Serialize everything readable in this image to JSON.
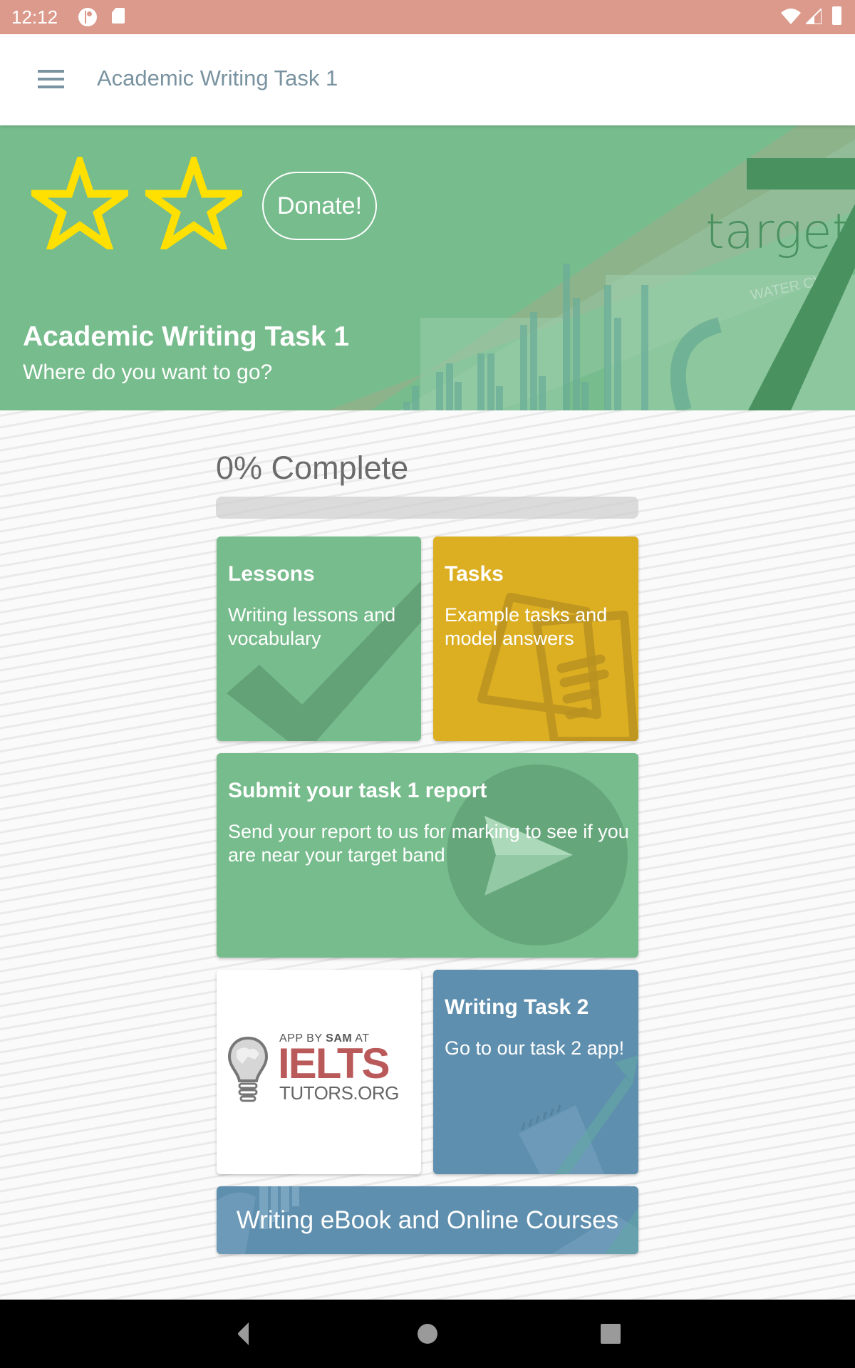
{
  "status_bar": {
    "time": "12:12",
    "icons": [
      "notification-ring-icon",
      "sd-card-icon",
      "wifi-icon",
      "cell-signal-icon",
      "battery-icon"
    ]
  },
  "app_bar": {
    "menu_icon": "hamburger-menu-icon",
    "title": "Academic Writing Task 1"
  },
  "hero": {
    "rating_stars": 2,
    "donate_label": "Donate!",
    "title": "Academic Writing Task 1",
    "subtitle": "Where do you want to go?",
    "background_word": "target",
    "colors": {
      "background": "#77bc8c",
      "star": "#ffe000"
    }
  },
  "progress": {
    "label": "0% Complete",
    "percent": 0
  },
  "tiles": {
    "lessons": {
      "title": "Lessons",
      "description": "Writing lessons and vocabulary",
      "icon": "checkmark-icon",
      "color": "#77bc8c"
    },
    "tasks": {
      "title": "Tasks",
      "description": "Example tasks and model answers",
      "icon": "documents-icon",
      "color": "#dcae22"
    },
    "submit": {
      "title": "Submit your task 1 report",
      "description": "Send your report to us for marking to see if you are near your target band",
      "icon": "paper-plane-icon",
      "color": "#77bc8c"
    },
    "logo": {
      "line1_prefix": "APP BY ",
      "line1_bold": "SAM",
      "line1_suffix": " AT",
      "brand": "IELTS",
      "line3": "TUTORS.ORG",
      "icon": "lightbulb-globe-icon"
    },
    "task2": {
      "title": "Writing Task 2",
      "description": "Go to our task 2 app!",
      "color": "#5f8fae"
    },
    "ebook": {
      "label": "Writing eBook and Online Courses",
      "color": "#5f8fae"
    }
  },
  "nav_bar": {
    "buttons": [
      "back",
      "home",
      "recents"
    ]
  }
}
